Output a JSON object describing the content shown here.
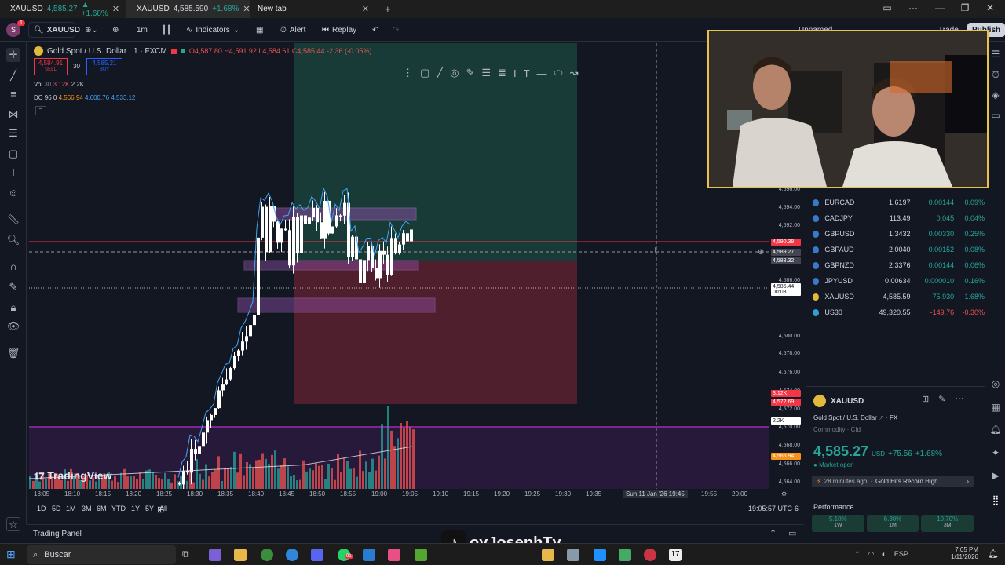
{
  "browser": {
    "tabs": [
      {
        "label": "XAUUSD",
        "price": "4,585.27",
        "change": "▲ +1.68%"
      },
      {
        "label": "XAUUSD",
        "price": "4,585.590",
        "change": "+1.68%"
      },
      {
        "label": "New tab"
      }
    ]
  },
  "toolbar": {
    "symbol": "XAUUSD",
    "interval": "1m",
    "indicators_label": "Indicators",
    "alert_label": "Alert",
    "replay_label": "Replay",
    "layout_name": "Unnamed",
    "trade_label": "Trade",
    "publish_label": "Publish",
    "notification_count": "1"
  },
  "legend": {
    "title": "Gold Spot / U.S. Dollar · 1 · FXCM",
    "ohlc": "O4,587.80 H4,591.92 L4,584.61 C4,585.44 -2.36 (-0.05%)",
    "sell_price": "4,584.91",
    "sell_label": "SELL",
    "spread": "30",
    "buy_price": "4,585.21",
    "buy_label": "BUY",
    "vol_label": "Vol",
    "vol_len": "30",
    "vol_a": "3.12K",
    "vol_b": "2.2K",
    "dc_label": "DC 96 0",
    "dc_a": "4,566.94",
    "dc_b": "4,600.76",
    "dc_c": "4,533.12"
  },
  "price_axis": {
    "labels": [
      "4,596.00",
      "4,594.00",
      "4,592.00",
      "4,590.00",
      "4,586.00",
      "4,582.00",
      "4,580.00",
      "4,578.00",
      "4,576.00",
      "4,574.00",
      "4,572.00",
      "4,570.00",
      "4,568.00",
      "4,566.00",
      "4,564.00"
    ],
    "tags": [
      {
        "text": "4,590.38",
        "color": "#f23645"
      },
      {
        "text": "4,589.27",
        "color": "#434651"
      },
      {
        "text": "4,588.32",
        "color": "#434651"
      },
      {
        "text": "4,585.44",
        "color": "#ffffff",
        "sub": "00:03"
      },
      {
        "text": "3.12K",
        "color": "#f23645"
      },
      {
        "text": "4,572.69",
        "color": "#f23645"
      },
      {
        "text": "2.2K",
        "color": "#ffffff"
      },
      {
        "text": "4,566.94",
        "color": "#f7931a"
      }
    ]
  },
  "time_axis": {
    "labels": [
      "18:05",
      "18:10",
      "18:15",
      "18:20",
      "18:25",
      "18:30",
      "18:35",
      "18:40",
      "18:45",
      "18:50",
      "18:55",
      "19:00",
      "19:05",
      "19:10",
      "19:15",
      "19:20",
      "19:25",
      "19:30",
      "19:35",
      "19:45",
      "19:55",
      "20:00"
    ],
    "crosshair_date": "Sun 11 Jan '26",
    "crosshair_time": "19:45"
  },
  "bottom_bar": {
    "ranges": [
      "1D",
      "5D",
      "1M",
      "3M",
      "6M",
      "YTD",
      "1Y",
      "5Y",
      "All"
    ],
    "clock": "19:05:57 UTC-6",
    "trading_panel": "Trading Panel"
  },
  "watermark": "TradingView",
  "watchlist": [
    {
      "symbol": "EURCAD",
      "last": "1.6197",
      "chg": "0.00144",
      "pct": "0.09%",
      "dot": "#3a78c9",
      "positive": true
    },
    {
      "symbol": "CADJPY",
      "last": "113.49",
      "chg": "0.045",
      "pct": "0.04%",
      "dot": "#3a78c9",
      "positive": true
    },
    {
      "symbol": "GBPUSD",
      "last": "1.3432",
      "chg": "0.00330",
      "pct": "0.25%",
      "dot": "#3a78c9",
      "positive": true
    },
    {
      "symbol": "GBPAUD",
      "last": "2.0040",
      "chg": "0.00152",
      "pct": "0.08%",
      "dot": "#3a78c9",
      "positive": true
    },
    {
      "symbol": "GBPNZD",
      "last": "2.3376",
      "chg": "0.00144",
      "pct": "0.06%",
      "dot": "#3a78c9",
      "positive": true
    },
    {
      "symbol": "JPYUSD",
      "last": "0.00634",
      "chg": "0.000010",
      "pct": "0.16%",
      "dot": "#3a78c9",
      "positive": true
    },
    {
      "symbol": "XAUUSD",
      "last": "4,585.59",
      "chg": "75.930",
      "pct": "1.68%",
      "dot": "#e0b93d",
      "positive": true
    },
    {
      "symbol": "US30",
      "last": "49,320.55",
      "chg": "-149.76",
      "pct": "-0.30%",
      "dot": "#2ea0d8",
      "positive": false
    }
  ],
  "detail": {
    "symbol": "XAUUSD",
    "name": "Gold Spot / U.S. Dollar",
    "exchange": "FX",
    "category": "Commodity · Cfd",
    "price": "4,585.27",
    "currency": "USD",
    "change": "+75.56",
    "change_pct": "+1.68%",
    "status": "Market open",
    "news_time": "28 minutes ago",
    "news_headline": "Gold Hits Record High",
    "performance_label": "Performance",
    "perf": [
      {
        "value": "5.10%",
        "period": "1W"
      },
      {
        "value": "6.30%",
        "period": "1M"
      },
      {
        "value": "10.70%",
        "period": "3M"
      }
    ]
  },
  "overlay": {
    "tiktok_handle": "oyJosephTv"
  },
  "taskbar": {
    "search_placeholder": "Buscar",
    "language": "ESP",
    "time": "7:05 PM",
    "date": "1/11/2026",
    "badge": "91"
  },
  "colors": {
    "up": "#26a69a",
    "down": "#ef5350",
    "accent": "#2962ff",
    "purple_line": "#9c27b0"
  }
}
